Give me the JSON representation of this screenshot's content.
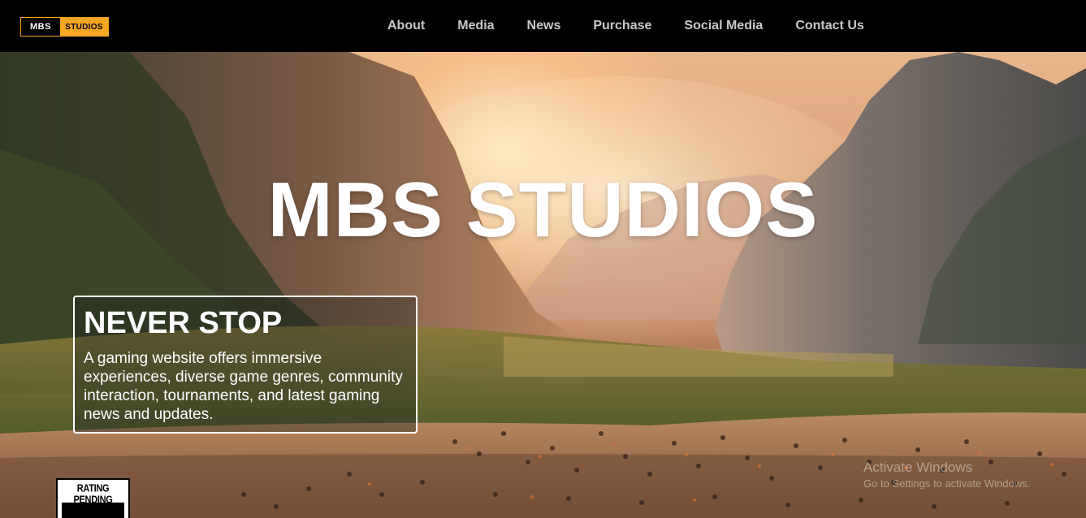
{
  "header": {
    "logo": {
      "left": "MBS",
      "right": "STUDIOS"
    },
    "nav": [
      "About",
      "Media",
      "News",
      "Purchase",
      "Social Media",
      "Contact Us"
    ]
  },
  "hero": {
    "title": "MBS STUDIOS",
    "card": {
      "heading": "NEVER STOP",
      "body": "A gaming website offers immersive experiences, diverse game genres, community interaction, tournaments, and latest gaming news and updates."
    },
    "rating_badge": "RATING PENDING"
  },
  "watermark": {
    "line1": "Activate Windows",
    "line2": "Go to Settings to activate Windows."
  },
  "colors": {
    "topbar": "#000000",
    "logo_accent": "#f5a623",
    "nav_text": "#c9c9c9",
    "title_text": "#ffffff"
  }
}
